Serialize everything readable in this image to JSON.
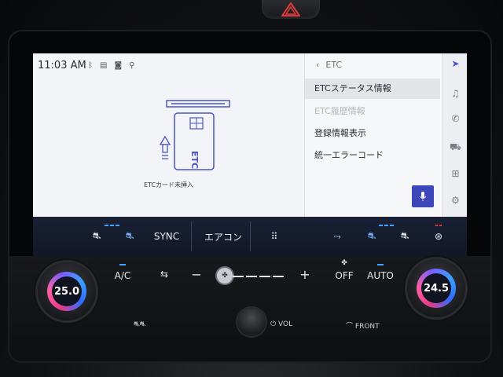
{
  "status": {
    "time": "11:03 AM",
    "icons": [
      "bluetooth-icon",
      "message-icon",
      "camera-icon",
      "location-icon"
    ]
  },
  "etc_screen": {
    "card_message": "ETCカード未挿入",
    "card_label": "ETC"
  },
  "menu": {
    "back_label": "ETC",
    "items": [
      {
        "label": "ETCステータス情報",
        "state": "selected"
      },
      {
        "label": "ETC履歴情報",
        "state": "disabled"
      },
      {
        "label": "登録情報表示",
        "state": "normal"
      },
      {
        "label": "統一エラーコード",
        "state": "normal"
      }
    ]
  },
  "side_rail": [
    "navigation-icon",
    "music-icon",
    "phone-icon",
    "car-icon",
    "apps-icon",
    "settings-icon"
  ],
  "climate_bar": {
    "sync": "SYNC",
    "aircon": "エアコン"
  },
  "panel": {
    "left_temp": "25.0",
    "right_temp": "24.5",
    "ac": "A/C",
    "off": "OFF",
    "auto": "AUTO",
    "minus": "−",
    "plus": "+",
    "vol": "VOL",
    "front": "FRONT"
  },
  "colors": {
    "accent_blue": "#3fa3ff",
    "mic_button": "#3d46b8",
    "climate_bg": "#1a2135",
    "red_indicator": "#e23a3a"
  }
}
